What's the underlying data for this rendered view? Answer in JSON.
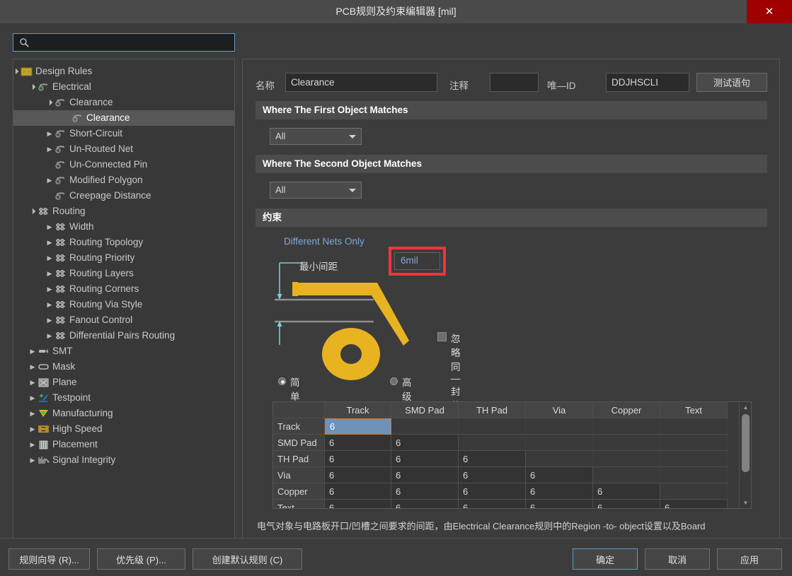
{
  "window": {
    "title": "PCB规则及约束编辑器 [mil]",
    "close_label": "✕",
    "close_color": "#a00000"
  },
  "search": {
    "value": "",
    "placeholder": "",
    "icon": "search-icon"
  },
  "tree": {
    "items": [
      {
        "label": "Design Rules",
        "depth": 0,
        "twisty": "down",
        "icon": "design-rules-icon",
        "selected": false
      },
      {
        "label": "Electrical",
        "depth": 1,
        "twisty": "down",
        "icon": "electrical-icon",
        "selected": false
      },
      {
        "label": "Clearance",
        "depth": 2,
        "twisty": "down",
        "icon": "electrical-icon",
        "selected": false
      },
      {
        "label": "Clearance",
        "depth": 3,
        "twisty": "none",
        "icon": "electrical-icon",
        "selected": true
      },
      {
        "label": "Short-Circuit",
        "depth": 2,
        "twisty": "right",
        "icon": "electrical-icon",
        "selected": false
      },
      {
        "label": "Un-Routed Net",
        "depth": 2,
        "twisty": "right",
        "icon": "electrical-icon",
        "selected": false
      },
      {
        "label": "Un-Connected Pin",
        "depth": 2,
        "twisty": "none",
        "icon": "electrical-icon",
        "selected": false
      },
      {
        "label": "Modified Polygon",
        "depth": 2,
        "twisty": "right",
        "icon": "electrical-icon",
        "selected": false
      },
      {
        "label": "Creepage Distance",
        "depth": 2,
        "twisty": "none",
        "icon": "electrical-icon",
        "selected": false
      },
      {
        "label": "Routing",
        "depth": 1,
        "twisty": "down",
        "icon": "routing-icon",
        "selected": false
      },
      {
        "label": "Width",
        "depth": 2,
        "twisty": "right",
        "icon": "routing-icon",
        "selected": false
      },
      {
        "label": "Routing Topology",
        "depth": 2,
        "twisty": "right",
        "icon": "routing-icon",
        "selected": false
      },
      {
        "label": "Routing Priority",
        "depth": 2,
        "twisty": "right",
        "icon": "routing-icon",
        "selected": false
      },
      {
        "label": "Routing Layers",
        "depth": 2,
        "twisty": "right",
        "icon": "routing-icon",
        "selected": false
      },
      {
        "label": "Routing Corners",
        "depth": 2,
        "twisty": "right",
        "icon": "routing-icon",
        "selected": false
      },
      {
        "label": "Routing Via Style",
        "depth": 2,
        "twisty": "right",
        "icon": "routing-icon",
        "selected": false
      },
      {
        "label": "Fanout Control",
        "depth": 2,
        "twisty": "right",
        "icon": "routing-icon",
        "selected": false
      },
      {
        "label": "Differential Pairs Routing",
        "depth": 2,
        "twisty": "right",
        "icon": "routing-icon",
        "selected": false
      },
      {
        "label": "SMT",
        "depth": 1,
        "twisty": "right",
        "icon": "smt-icon",
        "selected": false
      },
      {
        "label": "Mask",
        "depth": 1,
        "twisty": "right",
        "icon": "mask-icon",
        "selected": false
      },
      {
        "label": "Plane",
        "depth": 1,
        "twisty": "right",
        "icon": "plane-icon",
        "selected": false
      },
      {
        "label": "Testpoint",
        "depth": 1,
        "twisty": "right",
        "icon": "testpoint-icon",
        "selected": false
      },
      {
        "label": "Manufacturing",
        "depth": 1,
        "twisty": "right",
        "icon": "manufacturing-icon",
        "selected": false
      },
      {
        "label": "High Speed",
        "depth": 1,
        "twisty": "right",
        "icon": "high-speed-icon",
        "selected": false
      },
      {
        "label": "Placement",
        "depth": 1,
        "twisty": "right",
        "icon": "placement-icon",
        "selected": false
      },
      {
        "label": "Signal Integrity",
        "depth": 1,
        "twisty": "right",
        "icon": "signal-integrity-icon",
        "selected": false
      }
    ]
  },
  "form": {
    "name_label": "名称",
    "name_value": "Clearance",
    "comment_label": "注释",
    "comment_value": "",
    "unique_id_label": "唯—ID",
    "unique_id_value": "DDJHSCLI",
    "test_query_button": "测试语句"
  },
  "first_object": {
    "header": "Where The First Object Matches",
    "scope_value": "All"
  },
  "second_object": {
    "header": "Where The Second Object Matches",
    "scope_value": "All"
  },
  "constraints": {
    "header": "约束",
    "different_nets_only": "Different Nets Only",
    "min_clearance_label": "最小间距",
    "min_clearance_value": "6mil",
    "highlight_color": "#f5323c",
    "ignore_pad_checkbox_label": "忽略同—封装内的焊盘间距",
    "ignore_pad_checked": false,
    "mode_simple": "简单",
    "mode_advanced": "高级",
    "mode_selected": "简单"
  },
  "matrix": {
    "columns": [
      "",
      "Track",
      "SMD Pad",
      "TH Pad",
      "Via",
      "Copper",
      "Text"
    ],
    "rows": [
      {
        "label": "Track",
        "values": [
          "6",
          "",
          "",
          "",
          "",
          ""
        ]
      },
      {
        "label": "SMD Pad",
        "values": [
          "6",
          "6",
          "",
          "",
          "",
          ""
        ]
      },
      {
        "label": "TH Pad",
        "values": [
          "6",
          "6",
          "6",
          "",
          "",
          ""
        ]
      },
      {
        "label": "Via",
        "values": [
          "6",
          "6",
          "6",
          "6",
          "",
          ""
        ]
      },
      {
        "label": "Copper",
        "values": [
          "6",
          "6",
          "6",
          "6",
          "6",
          ""
        ]
      },
      {
        "label": "Text",
        "values": [
          "6",
          "6",
          "6",
          "6",
          "6",
          "6"
        ]
      }
    ],
    "selected_cell": {
      "row": 0,
      "col": 0
    }
  },
  "description": "电气对象与电路板开口/凹槽之间要求的间距，由Electrical Clearance规则中的Region -to- object设置以及Board",
  "footer": {
    "rule_wizard": "规则向导 (R)...",
    "priority": "优先级 (P)...",
    "create_default": "创建默认规则 (C)",
    "ok": "确定",
    "cancel": "取消",
    "apply": "应用"
  }
}
